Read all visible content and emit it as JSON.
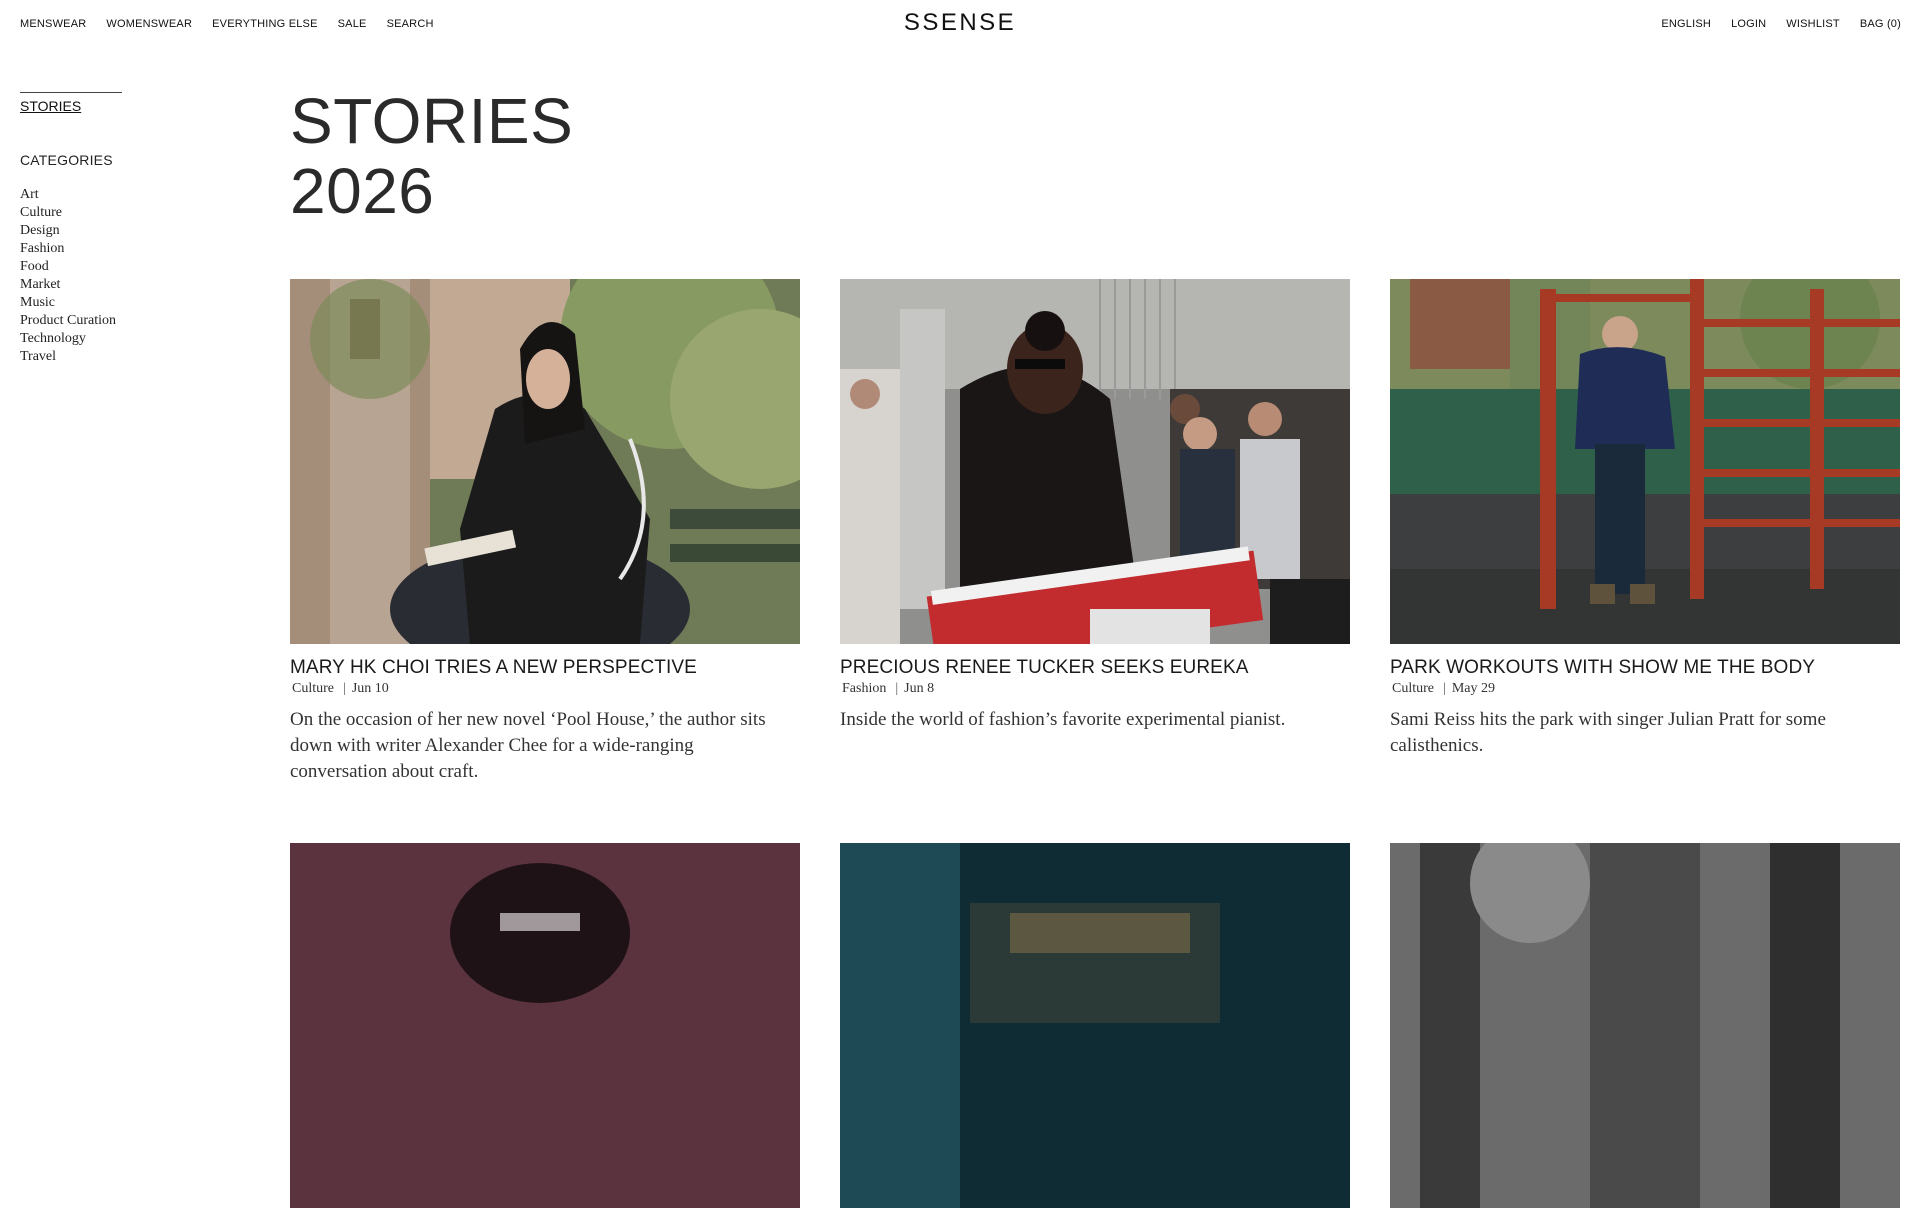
{
  "nav": {
    "left": [
      "MENSWEAR",
      "WOMENSWEAR",
      "EVERYTHING ELSE",
      "SALE",
      "SEARCH"
    ],
    "right": [
      "ENGLISH",
      "LOGIN",
      "WISHLIST",
      "BAG (0)"
    ],
    "logo": "SSENSE"
  },
  "sidebar": {
    "stories_link": "STORIES",
    "categories_heading": "CATEGORIES",
    "categories": [
      "Art",
      "Culture",
      "Design",
      "Fashion",
      "Food",
      "Market",
      "Music",
      "Product Curation",
      "Technology",
      "Travel"
    ]
  },
  "page": {
    "title_line1": "STORIES",
    "title_line2": "2026"
  },
  "stories": [
    {
      "title": "MARY HK CHOI TRIES A NEW PERSPECTIVE",
      "category": "Culture",
      "date": "Jun 10",
      "description": "On the occasion of her new novel ‘Pool House,’ the author sits down with writer Alexander Chee for a wide-ranging conversation about craft."
    },
    {
      "title": "PRECIOUS RENEE TUCKER SEEKS EUREKA",
      "category": "Fashion",
      "date": "Jun 8",
      "description": "Inside the world of fashion’s favorite experimental pianist."
    },
    {
      "title": "PARK WORKOUTS WITH SHOW ME THE BODY",
      "category": "Culture",
      "date": "May 29",
      "description": "Sami Reiss hits the park with singer Julian Pratt for some calisthenics."
    }
  ]
}
